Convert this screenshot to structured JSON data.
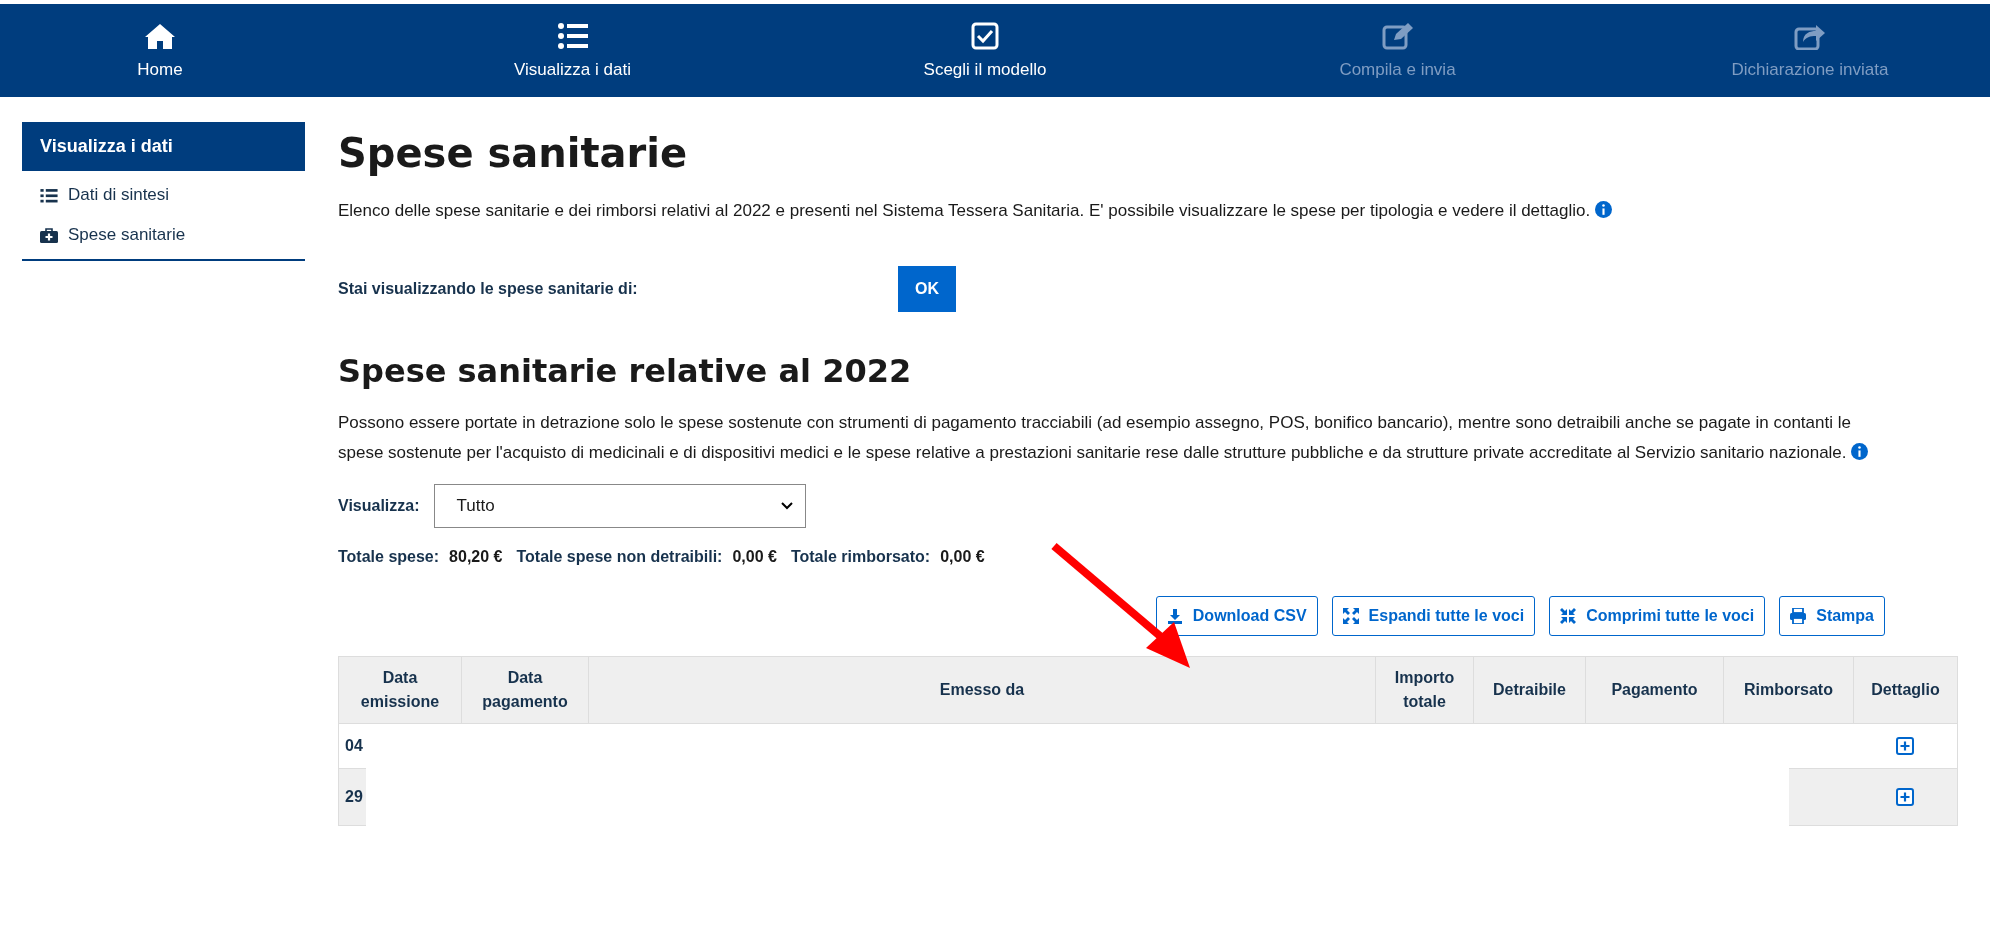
{
  "nav": [
    {
      "label": "Home",
      "disabled": false
    },
    {
      "label": "Visualizza i dati",
      "disabled": false
    },
    {
      "label": "Scegli il modello",
      "disabled": false
    },
    {
      "label": "Compila e invia",
      "disabled": true
    },
    {
      "label": "Dichiarazione inviata",
      "disabled": true
    }
  ],
  "sidebar": {
    "title": "Visualizza i dati",
    "items": [
      {
        "label": "Dati di sintesi"
      },
      {
        "label": "Spese sanitarie"
      }
    ]
  },
  "page_title": "Spese sanitarie",
  "intro": "Elenco delle spese sanitarie e dei rimborsi relativi al 2022 e presenti nel Sistema Tessera Sanitaria. E' possibile visualizzare le spese per tipologia e vedere il dettaglio.",
  "viewing_label": "Stai visualizzando le spese sanitarie di:",
  "ok_button": "OK",
  "section_title": "Spese sanitarie relative al 2022",
  "section_text": "Possono essere portate in detrazione solo le spese sostenute con strumenti di pagamento tracciabili (ad esempio assegno, POS, bonifico bancario), mentre sono detraibili anche se pagate in contanti le spese sostenute per l'acquisto di medicinali e di dispositivi medici e le spese relative a prestazioni sanitarie rese dalle strutture pubbliche e da strutture private accreditate al Servizio sanitario nazionale.",
  "filter": {
    "label": "Visualizza:",
    "value": "Tutto"
  },
  "totals": [
    {
      "label": "Totale spese:",
      "value": "80,20 €"
    },
    {
      "label": "Totale spese non detraibili:",
      "value": "0,00 €"
    },
    {
      "label": "Totale rimborsato:",
      "value": "0,00 €"
    }
  ],
  "actions": [
    {
      "label": "Download CSV",
      "kind": "download"
    },
    {
      "label": "Espandi tutte le voci",
      "kind": "expand"
    },
    {
      "label": "Comprimi tutte le voci",
      "kind": "collapse"
    },
    {
      "label": "Stampa",
      "kind": "print"
    }
  ],
  "table": {
    "columns": [
      "Data emissione",
      "Data pagamento",
      "Emesso da",
      "Importo totale",
      "Detraibile",
      "Pagamento",
      "Rimborsato",
      "Dettaglio"
    ],
    "rows": [
      {
        "column_1": "04"
      },
      {
        "column_1": "29"
      }
    ]
  }
}
